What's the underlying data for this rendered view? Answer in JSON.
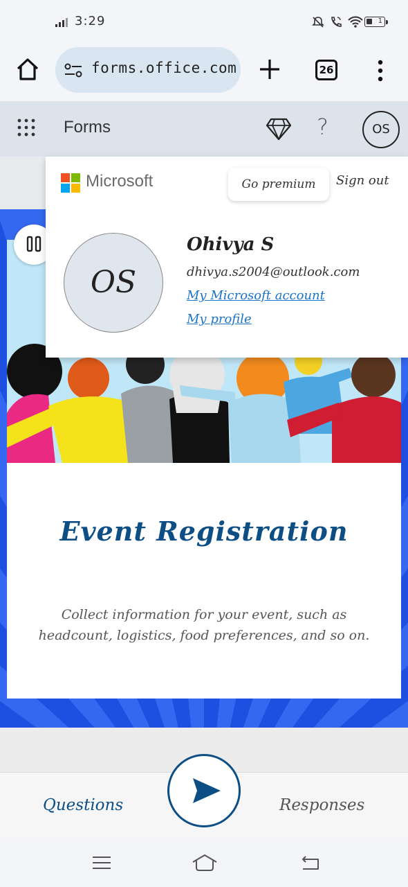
{
  "status_bar": {
    "time": "3:29",
    "battery_level": "1",
    "icons": [
      "signal-icon",
      "mute-icon",
      "wifi-call-icon",
      "wifi-icon",
      "battery-icon"
    ]
  },
  "browser": {
    "url": "forms.office.com",
    "tab_count": "26",
    "icons": [
      "home-icon",
      "site-info-icon",
      "plus-icon",
      "more-vert-icon"
    ]
  },
  "app_header": {
    "title": "Forms",
    "avatar_initials": "OS",
    "help_label": "?"
  },
  "account_popup": {
    "brand": "Microsoft",
    "go_premium": "Go premium",
    "sign_out": "Sign out",
    "avatar_initials": "OS",
    "user_name": "Ohivya S",
    "email": "dhivya.s2004@outlook.com",
    "account_link": "My Microsoft account",
    "profile_link": "My profile"
  },
  "form": {
    "title": "Event Registration",
    "description": "Collect information for your event, such as headcount, logistics, food preferences, and so on."
  },
  "bottom_tabs": {
    "questions": "Questions",
    "responses": "Responses"
  },
  "colors": {
    "primary": "#0d4e85",
    "link": "#1a73c6",
    "canvas_blue": "#1d4fe0"
  }
}
